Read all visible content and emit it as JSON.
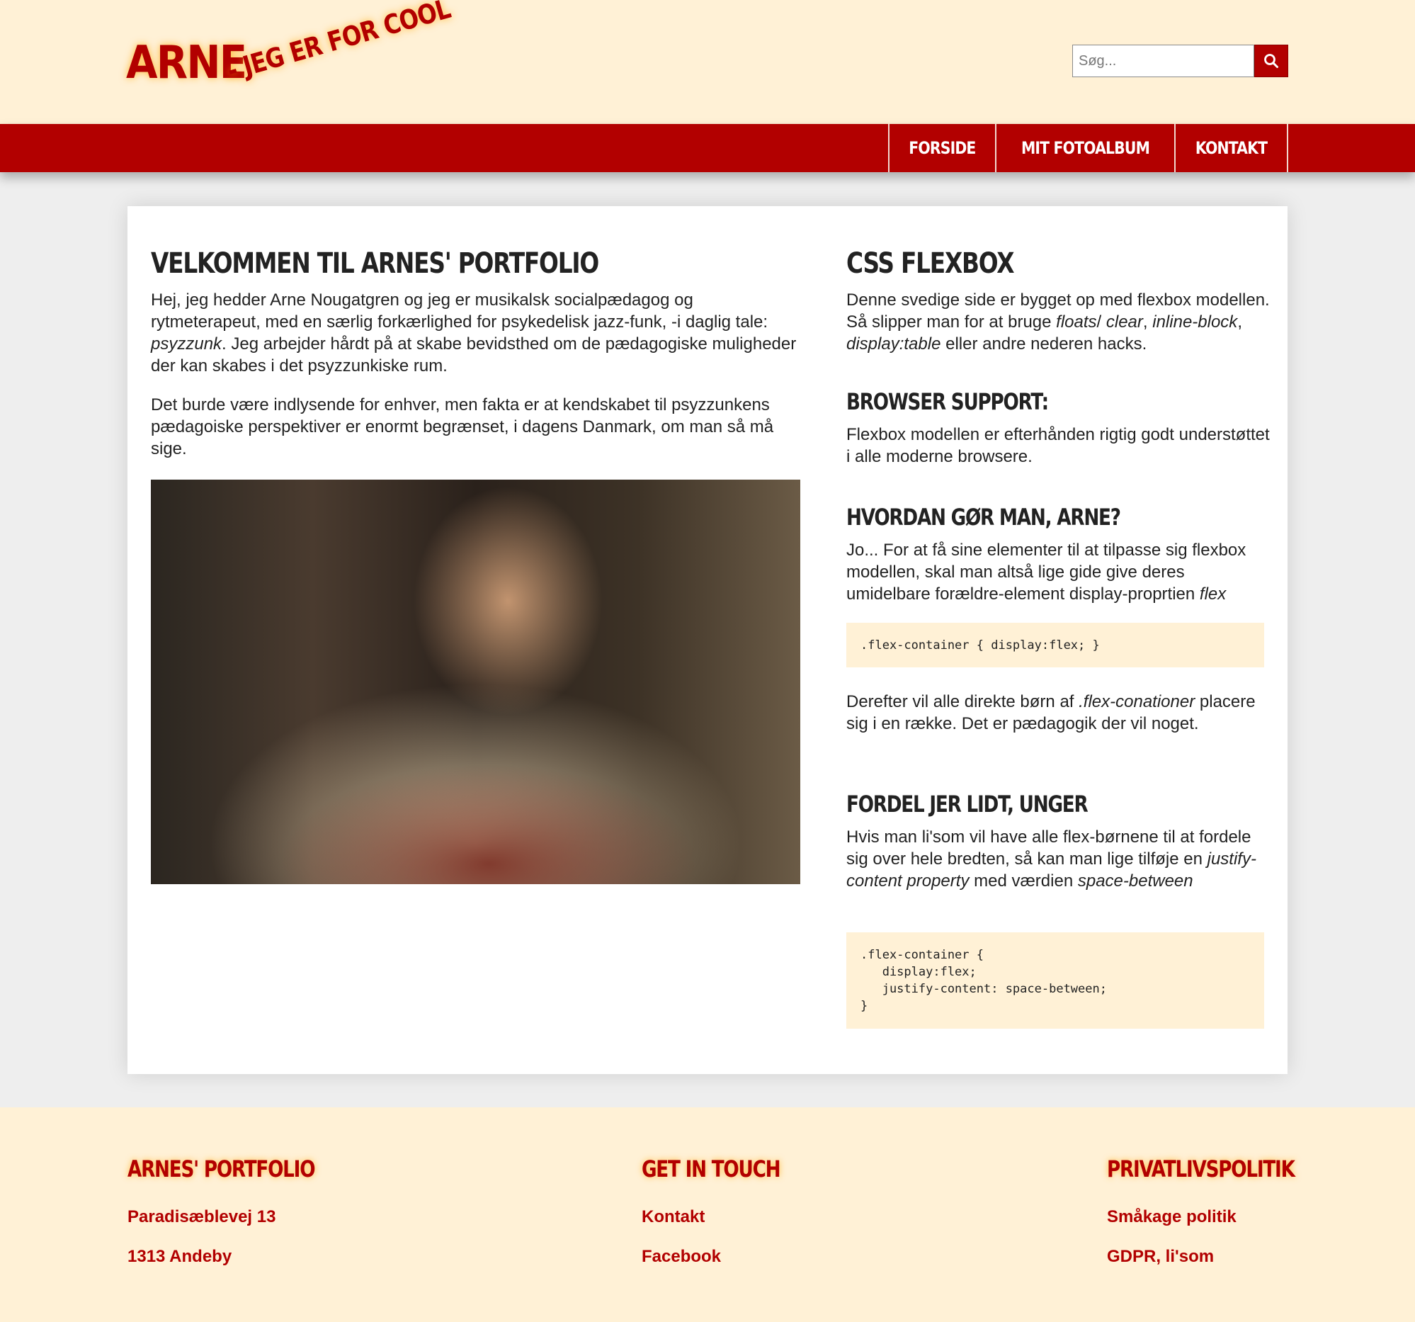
{
  "header": {
    "logo_main": "ARNE",
    "logo_sub": "- JEG ER FOR COOL",
    "search_placeholder": "Søg...",
    "search_icon": "search-icon"
  },
  "nav": {
    "items": [
      {
        "label": "FORSIDE"
      },
      {
        "label": "MIT FOTOALBUM"
      },
      {
        "label": "KONTAKT"
      }
    ]
  },
  "main": {
    "left": {
      "title": "VELKOMMEN TIL ARNES' PORTFOLIO",
      "para1": "Hej, jeg hedder Arne Nougatgren og jeg er musikalsk socialpædagog og rytmeterapeut, med en særlig forkærlighed for psykedelisk jazz-funk, -i daglig tale: <em>psyzzunk</em>. Jeg arbejder hårdt på at skabe bevidsthed om de pædagogiske muligheder der kan skabes i det psyzzunkiske rum.",
      "para2": "Det burde være indlysende for enhver, men fakta er at kendskabet til psyzzunkens pædagoiske perspektiver er enormt begrænset, i dagens Danmark, om man så må sige."
    },
    "right": {
      "title": "CSS FLEXBOX",
      "intro": "Denne svedige side er bygget op med flexbox modellen. Så slipper man for at bruge <em>floats</em>/ <em>clear</em>, <em>inline-block</em>, <em>display:table</em> eller andre nederen hacks.",
      "support_title": "BROWSER SUPPORT:",
      "support_text": "Flexbox modellen er efterhånden rigtig godt understøttet i alle moderne browsere.",
      "how_title": "HVORDAN GØR MAN, ARNE?",
      "how_text": "Jo... For at få sine elementer til at tilpasse sig flexbox modellen, skal man altså lige gide give deres umidelbare forældre-element display-proprtien <em>flex</em>",
      "code1": ".flex-container { display:flex; }",
      "after_text": "Derefter vil alle direkte børn af <em>.flex-conationer</em> placere sig i en række. Det er pædagogik der vil noget.",
      "distribute_title": "FORDEL JER LIDT, UNGER",
      "distribute_text": "Hvis man li'som vil have alle flex-børnene til at fordele sig over hele bredten, så kan man lige tilføje en <em>justify-content property</em> med værdien <em>space-between</em>",
      "code2": ".flex-container {\n   display:flex;\n   justify-content: space-between;\n}"
    }
  },
  "footer": {
    "col1": {
      "title": "ARNES' PORTFOLIO",
      "line1": "Paradisæblevej 13",
      "line2": "1313 Andeby"
    },
    "col2": {
      "title": "GET IN TOUCH",
      "link1": "Kontakt",
      "link2": "Facebook"
    },
    "col3": {
      "title": "PRIVATLIVSPOLITIK",
      "link1": "Småkage politik",
      "link2": "GDPR, li'som"
    }
  },
  "colors": {
    "brand_red": "#b20000",
    "cream": "#fff1d6",
    "page_gray": "#eeeeee"
  }
}
